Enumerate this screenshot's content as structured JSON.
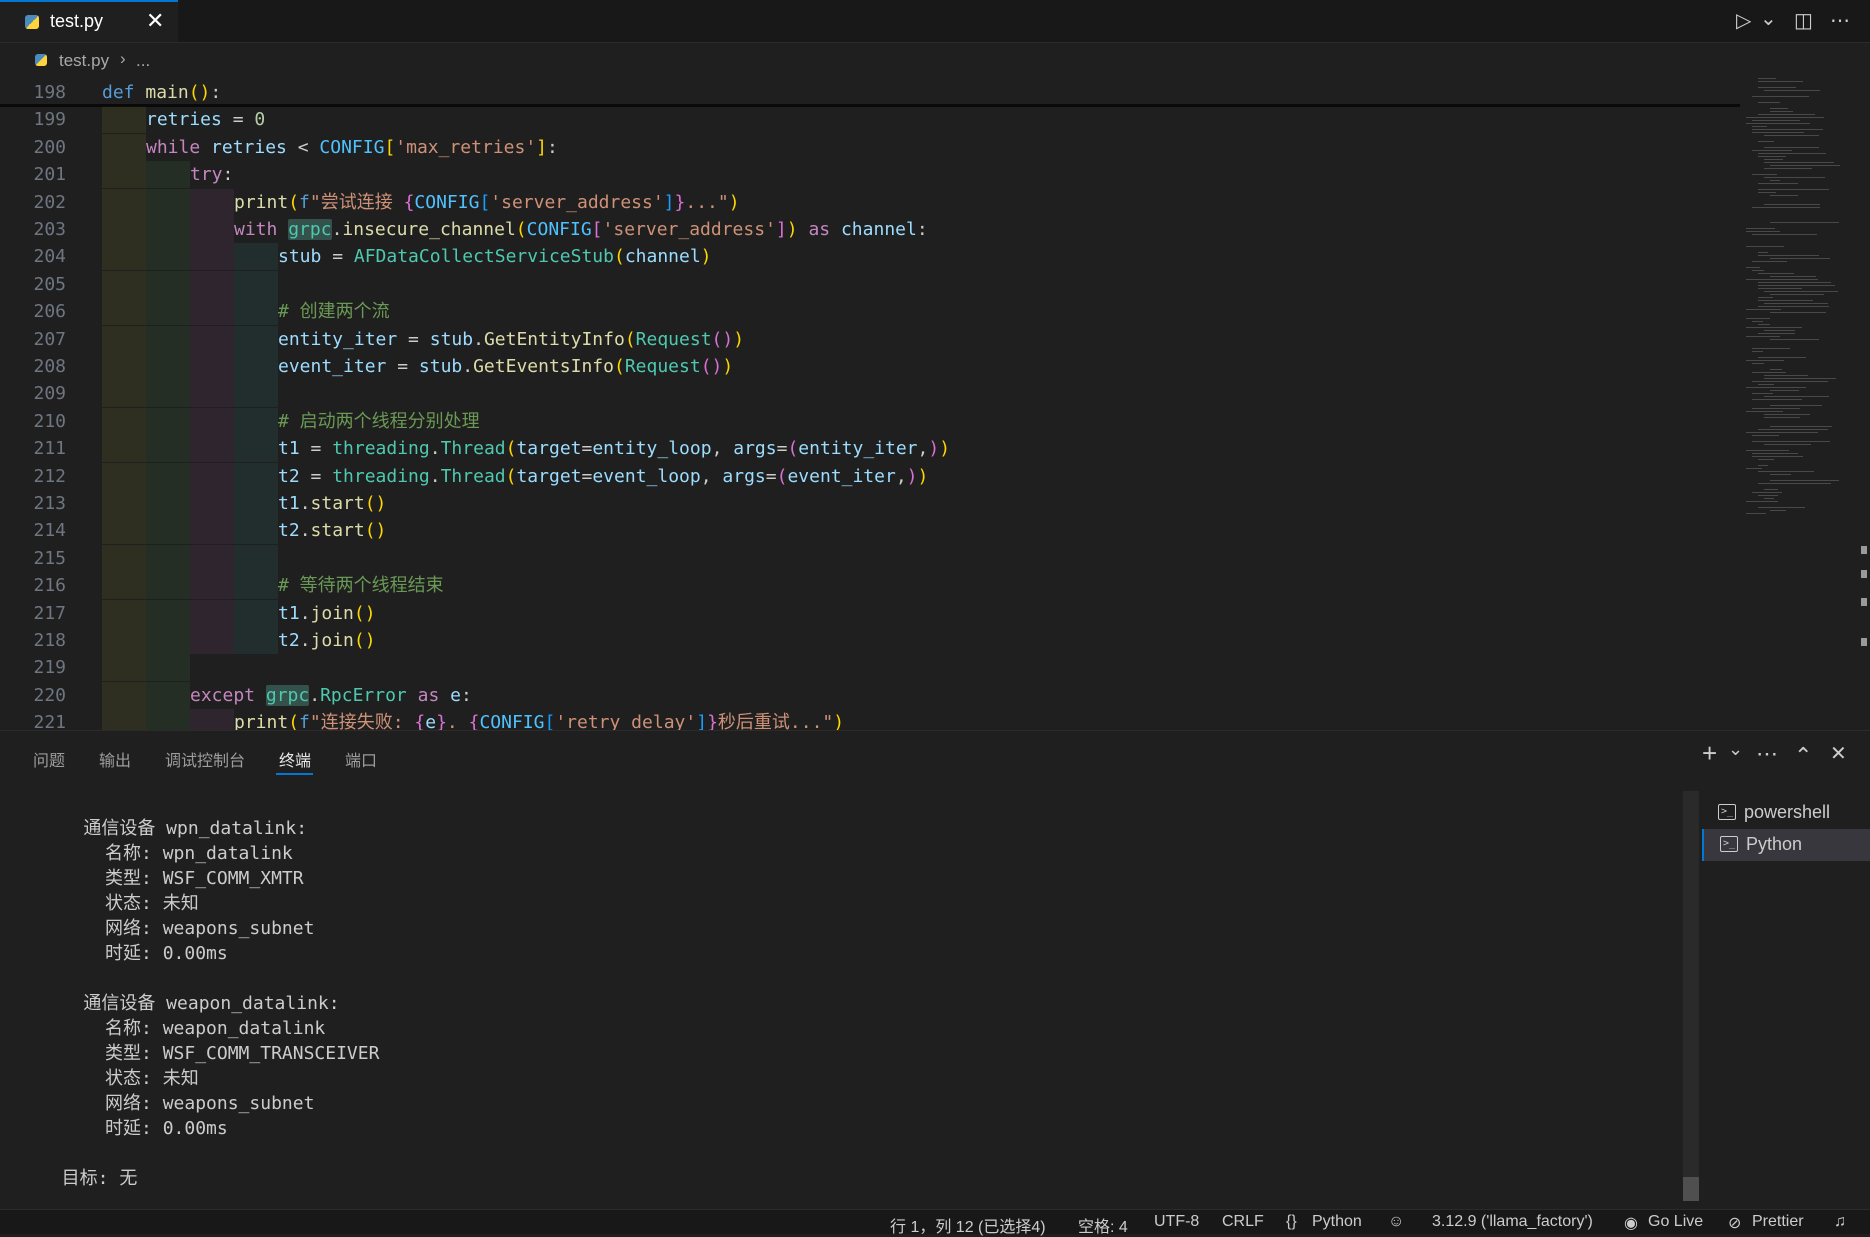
{
  "tab": {
    "filename": "test.py",
    "close_glyph": "✕"
  },
  "toolbar": {
    "run_glyph": "▷",
    "run_menu_glyph": "⌄",
    "split_glyph": "◫",
    "more_glyph": "⋯"
  },
  "breadcrumb": {
    "file": "test.py",
    "sep": "›",
    "more": "..."
  },
  "editor_lines": [
    {
      "n": "198",
      "indent": 0,
      "html": "<span class='kw'>def</span> <span class='fn'>main</span><span class='p1'>()</span>:"
    },
    {
      "n": "199",
      "indent": 1,
      "html": "<span class='var'>retries</span> = <span class='num'>0</span>"
    },
    {
      "n": "200",
      "indent": 1,
      "html": "<span class='kc'>while</span> <span class='var'>retries</span> &lt; <span class='const'>CONFIG</span><span class='p1'>[</span><span class='str'>'max_retries'</span><span class='p1'>]</span>:"
    },
    {
      "n": "201",
      "indent": 2,
      "html": "<span class='kc'>try</span>:"
    },
    {
      "n": "202",
      "indent": 3,
      "html": "<span class='fn'>print</span><span class='p1'>(</span><span class='kw'>f</span><span class='str'>\"尝试连接 </span><span class='p2'>{</span><span class='const'>CONFIG</span><span class='p3'>[</span><span class='str'>'server_address'</span><span class='p3'>]</span><span class='p2'>}</span><span class='str'>...\"</span><span class='p1'>)</span>"
    },
    {
      "n": "203",
      "indent": 3,
      "html": "<span class='kc'>with</span> <span class='cls hl'>grpc</span>.<span class='fn'>insecure_channel</span><span class='p1'>(</span><span class='const'>CONFIG</span><span class='p2'>[</span><span class='str'>'server_address'</span><span class='p2'>]</span><span class='p1'>)</span> <span class='kc'>as</span> <span class='var'>channel</span>:"
    },
    {
      "n": "204",
      "indent": 4,
      "html": "<span class='var'>stub</span> = <span class='cls'>AFDataCollectServiceStub</span><span class='p1'>(</span><span class='var'>channel</span><span class='p1'>)</span>"
    },
    {
      "n": "205",
      "indent": 4,
      "html": ""
    },
    {
      "n": "206",
      "indent": 4,
      "html": "<span class='cm'># 创建两个流</span>"
    },
    {
      "n": "207",
      "indent": 4,
      "html": "<span class='var'>entity_iter</span> = <span class='var'>stub</span>.<span class='fn'>GetEntityInfo</span><span class='p1'>(</span><span class='cls'>Request</span><span class='p2'>()</span><span class='p1'>)</span>"
    },
    {
      "n": "208",
      "indent": 4,
      "html": "<span class='var'>event_iter</span> = <span class='var'>stub</span>.<span class='fn'>GetEventsInfo</span><span class='p1'>(</span><span class='cls'>Request</span><span class='p2'>()</span><span class='p1'>)</span>"
    },
    {
      "n": "209",
      "indent": 4,
      "html": ""
    },
    {
      "n": "210",
      "indent": 4,
      "html": "<span class='cm'># 启动两个线程分别处理</span>"
    },
    {
      "n": "211",
      "indent": 4,
      "html": "<span class='var'>t1</span> = <span class='cls'>threading</span>.<span class='cls'>Thread</span><span class='p1'>(</span><span class='var'>target</span>=<span class='var'>entity_loop</span>, <span class='var'>args</span>=<span class='p2'>(</span><span class='var'>entity_iter</span>,<span class='p2'>)</span><span class='p1'>)</span>"
    },
    {
      "n": "212",
      "indent": 4,
      "html": "<span class='var'>t2</span> = <span class='cls'>threading</span>.<span class='cls'>Thread</span><span class='p1'>(</span><span class='var'>target</span>=<span class='var'>event_loop</span>, <span class='var'>args</span>=<span class='p2'>(</span><span class='var'>event_iter</span>,<span class='p2'>)</span><span class='p1'>)</span>"
    },
    {
      "n": "213",
      "indent": 4,
      "html": "<span class='var'>t1</span>.<span class='fn'>start</span><span class='p1'>()</span>"
    },
    {
      "n": "214",
      "indent": 4,
      "html": "<span class='var'>t2</span>.<span class='fn'>start</span><span class='p1'>()</span>"
    },
    {
      "n": "215",
      "indent": 4,
      "html": ""
    },
    {
      "n": "216",
      "indent": 4,
      "html": "<span class='cm'># 等待两个线程结束</span>"
    },
    {
      "n": "217",
      "indent": 4,
      "html": "<span class='var'>t1</span>.<span class='fn'>join</span><span class='p1'>()</span>"
    },
    {
      "n": "218",
      "indent": 4,
      "html": "<span class='var'>t2</span>.<span class='fn'>join</span><span class='p1'>()</span>"
    },
    {
      "n": "219",
      "indent": 2,
      "html": ""
    },
    {
      "n": "220",
      "indent": 2,
      "html": "<span class='kc'>except</span> <span class='cls hl'>grpc</span>.<span class='cls'>RpcError</span> <span class='kc'>as</span> <span class='var'>e</span>:"
    },
    {
      "n": "221",
      "indent": 3,
      "html": "<span class='fn'>print</span><span class='p1'>(</span><span class='kw'>f</span><span class='str'>\"连接失败: </span><span class='p2'>{</span><span class='var'>e</span><span class='p2'>}</span><span class='str'>. </span><span class='p2'>{</span><span class='const'>CONFIG</span><span class='p3'>[</span><span class='str'>'retry_delay'</span><span class='p3'>]</span><span class='p2'>}</span><span class='str'>秒后重试...\"</span><span class='p1'>)</span>"
    }
  ],
  "panel": {
    "tabs": [
      "问题",
      "输出",
      "调试控制台",
      "终端",
      "端口"
    ],
    "active_tab": "终端",
    "actions": {
      "new_terminal": "+",
      "new_terminal_menu": "⌄",
      "more": "⋯",
      "maximize": "⌃",
      "close": "✕"
    }
  },
  "terminal_output": [
    "",
    "    通信设备 wpn_datalink:",
    "      名称: wpn_datalink",
    "      类型: WSF_COMM_XMTR",
    "      状态: 未知",
    "      网络: weapons_subnet",
    "      时延: 0.00ms",
    "",
    "    通信设备 weapon_datalink:",
    "      名称: weapon_datalink",
    "      类型: WSF_COMM_TRANSCEIVER",
    "      状态: 未知",
    "      网络: weapons_subnet",
    "      时延: 0.00ms",
    "",
    "  目标: 无"
  ],
  "terminal_list": [
    {
      "name": "powershell",
      "selected": false
    },
    {
      "name": "Python",
      "selected": true
    }
  ],
  "statusbar": {
    "position": "行 1，列 12 (已选择4)",
    "spaces": "空格: 4",
    "encoding": "UTF-8",
    "eol": "CRLF",
    "language_braces": "{}",
    "language": "Python",
    "copilot_glyph": "☺",
    "interpreter": "3.12.9 ('llama_factory')",
    "golive_glyph": "◉",
    "golive": "Go Live",
    "prettier_glyph": "⊘",
    "prettier": "Prettier",
    "bell_glyph": "♫"
  }
}
